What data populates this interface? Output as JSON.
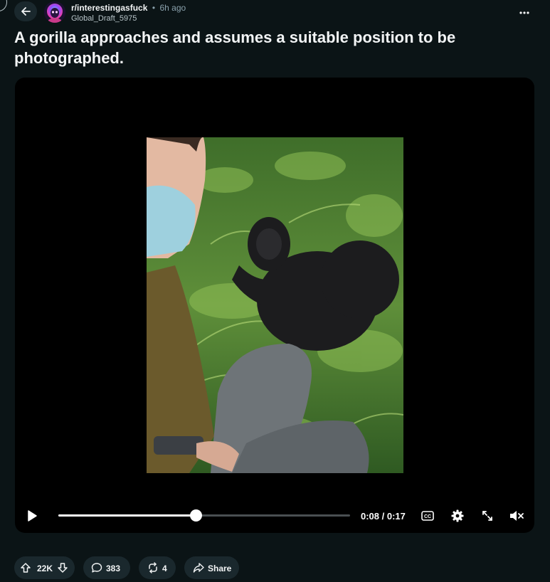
{
  "post": {
    "subreddit": "r/interestingasfuck",
    "separator": "•",
    "time": "6h ago",
    "author": "Global_Draft_5975",
    "title": "A gorilla approaches and assumes a suitable position to be photographed."
  },
  "video": {
    "current_time": "0:08",
    "duration": "0:17",
    "time_display": "0:08 / 0:17",
    "progress": 0.4706,
    "cc_label": "CC",
    "muted": true
  },
  "actions": {
    "upvotes": "22K",
    "comments": "383",
    "crossposts": "4",
    "share_label": "Share"
  },
  "icons": {
    "back": "arrow-left-icon",
    "more": "ellipsis-icon",
    "play": "play-icon",
    "settings": "gear-icon",
    "fullscreen": "expand-icon",
    "mute": "speaker-muted-icon",
    "upvote": "arrow-up-icon",
    "downvote": "arrow-down-icon",
    "comment": "speech-bubble-icon",
    "crosspost": "crosspost-icon",
    "share": "share-arrow-icon"
  },
  "colors": {
    "background": "#0b1416",
    "pill": "#1a282d",
    "text": "#f2f4f5",
    "muted_text": "#8ba2ad"
  }
}
